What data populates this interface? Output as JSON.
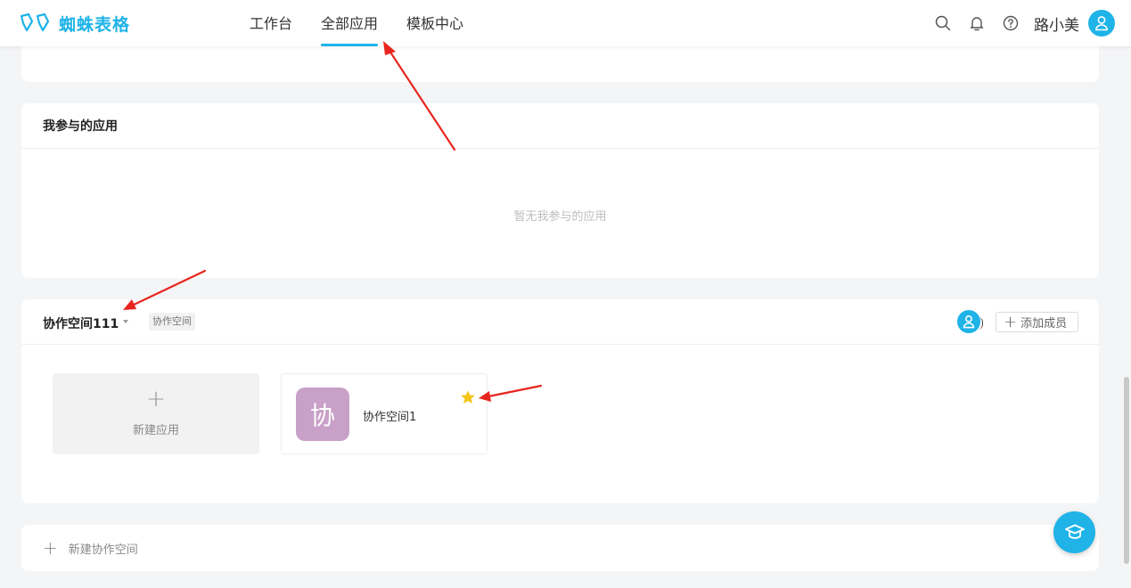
{
  "header": {
    "brand": "蜘蛛表格",
    "nav": [
      {
        "label": "工作台",
        "active": false
      },
      {
        "label": "全部应用",
        "active": true
      },
      {
        "label": "模板中心",
        "active": false
      }
    ],
    "username": "路小美",
    "icons": [
      "search-icon",
      "bell-icon",
      "help-icon",
      "user-icon"
    ]
  },
  "my_apps": {
    "title": "我参与的应用",
    "empty_text": "暂无我参与的应用"
  },
  "space": {
    "name": "协作空间111",
    "tag": "协作空间",
    "add_member_label": "添加成员",
    "new_app_label": "新建应用",
    "apps": [
      {
        "icon_char": "协",
        "name": "协作空间1",
        "starred": true
      }
    ]
  },
  "new_space_label": "新建协作空间",
  "colors": {
    "accent": "#1fb3e8",
    "app_icon_bg": "#c8a0c8",
    "star": "#f5c518",
    "annotation_arrow": "#e8261f"
  }
}
